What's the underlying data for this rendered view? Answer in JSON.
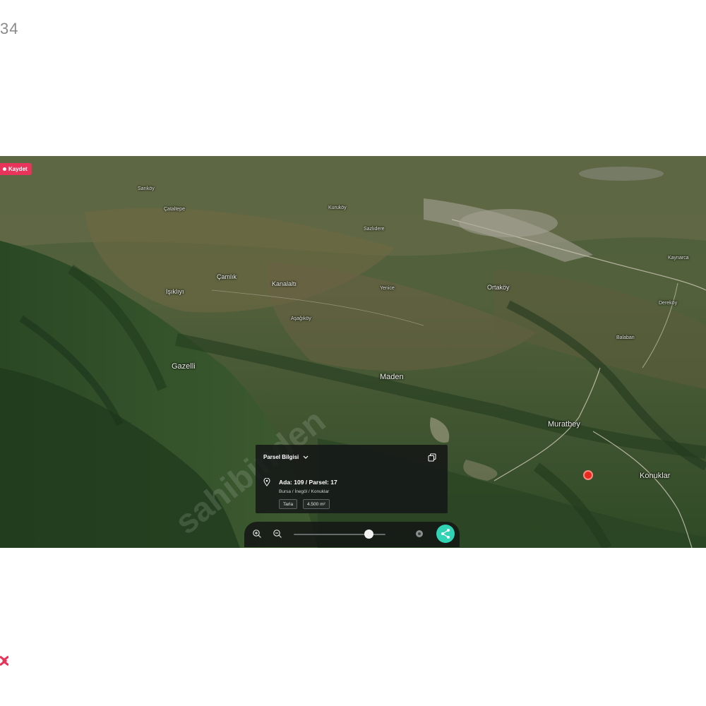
{
  "page": {
    "corner_number": "34"
  },
  "map": {
    "record_badge": "Kaydet",
    "places": [
      {
        "name": "Gazelli",
        "size": "big"
      },
      {
        "name": "Maden",
        "size": "big"
      },
      {
        "name": "Muratbey",
        "size": "big"
      },
      {
        "name": "Konuklar",
        "size": "big"
      },
      {
        "name": "Işıklıyı",
        "size": "normal"
      },
      {
        "name": "Kanalaltı",
        "size": "normal"
      },
      {
        "name": "Çamlık",
        "size": "normal"
      },
      {
        "name": "Ortaköy",
        "size": "normal"
      },
      {
        "name": "Sarıköy",
        "size": "small"
      },
      {
        "name": "Çataltepe",
        "size": "small"
      },
      {
        "name": "Kuruköy",
        "size": "small"
      },
      {
        "name": "Sazlıdere",
        "size": "small"
      },
      {
        "name": "Yenice",
        "size": "small"
      },
      {
        "name": "Aşağıköy",
        "size": "small"
      },
      {
        "name": "Kaynarca",
        "size": "small"
      },
      {
        "name": "Dereköy",
        "size": "small"
      },
      {
        "name": "Balaban",
        "size": "small"
      }
    ],
    "watermark": "sahibinden"
  },
  "parcel_panel": {
    "header": "Parsel Bilgisi",
    "title": "Ada: 109 / Parsel: 17",
    "location": "Bursa / İnegöl / Konuklar",
    "chips": [
      "Tarla",
      "4.500 m²"
    ]
  },
  "controls": {
    "zoom_level": 0.82
  },
  "colors": {
    "badge": "#e8345a",
    "pin": "#e82a1e",
    "share": "#31d3b5"
  },
  "icons": [
    "zoom-in-icon",
    "zoom-out-icon",
    "share-icon",
    "copy-icon",
    "location-pin-icon",
    "chevron-down-icon"
  ]
}
